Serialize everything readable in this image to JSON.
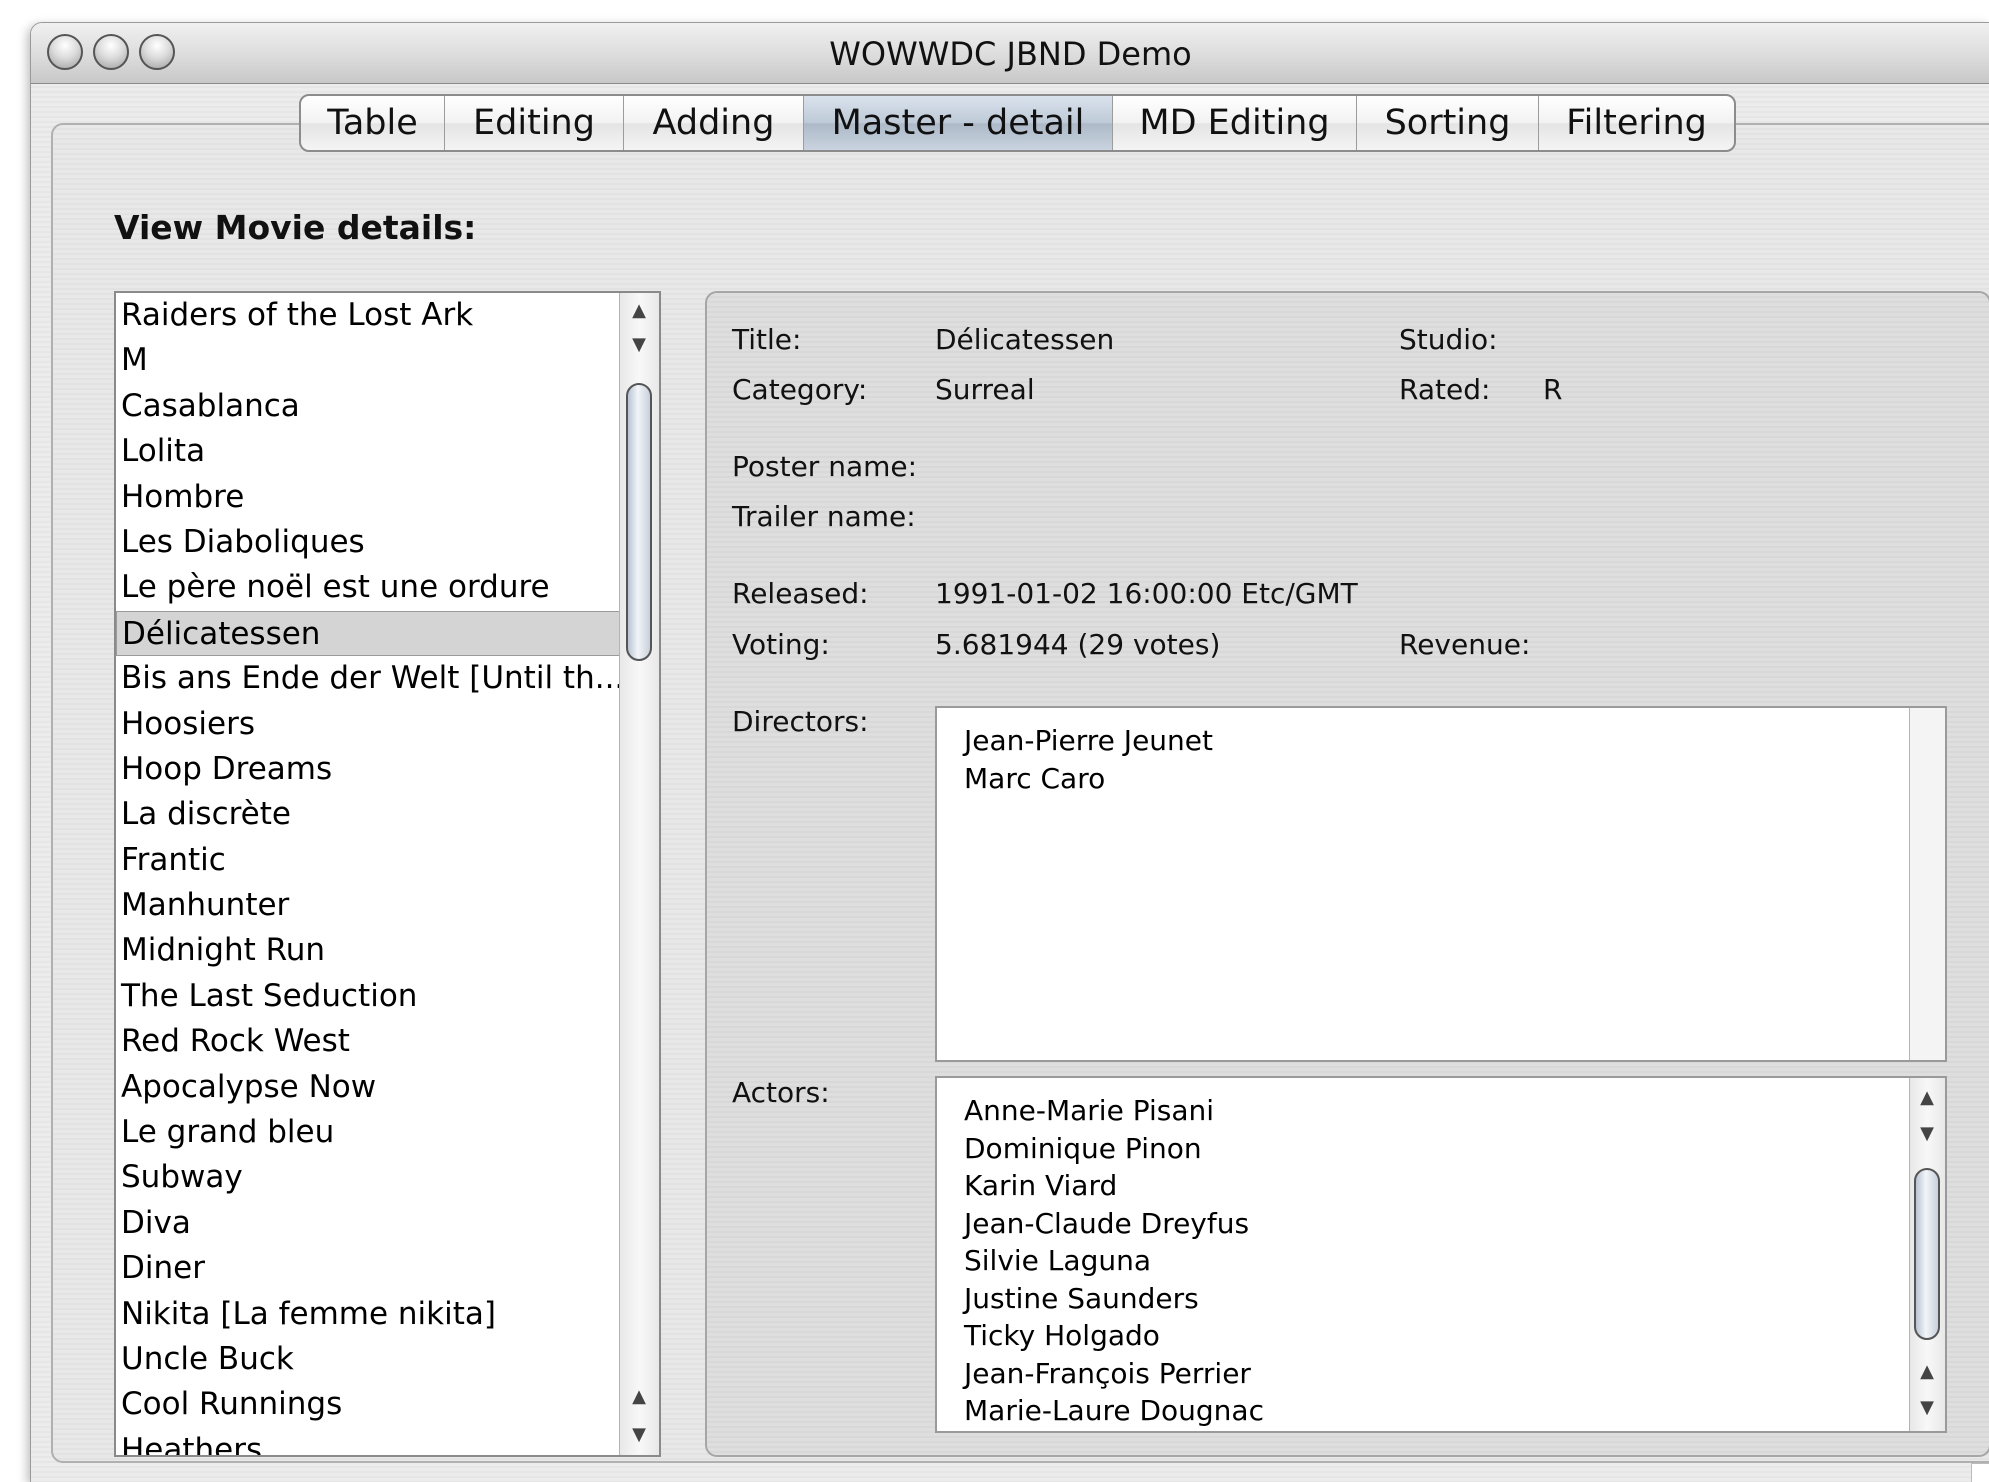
{
  "window": {
    "title": "WOWWDC JBND Demo"
  },
  "tabs": [
    {
      "label": "Table"
    },
    {
      "label": "Editing"
    },
    {
      "label": "Adding"
    },
    {
      "label": "Master - detail"
    },
    {
      "label": "MD Editing"
    },
    {
      "label": "Sorting"
    },
    {
      "label": "Filtering"
    }
  ],
  "active_tab": "Master - detail",
  "section_title": "View Movie details:",
  "movies": [
    "Raiders of the Lost Ark",
    "M",
    "Casablanca",
    "Lolita",
    "Hombre",
    "Les Diaboliques",
    "Le père noël est une ordure",
    "Délicatessen",
    "Bis ans Ende der Welt [Until th...",
    "Hoosiers",
    "Hoop Dreams",
    "La discrète",
    "Frantic",
    "Manhunter",
    "Midnight Run",
    "The Last Seduction",
    "Red Rock West",
    "Apocalypse Now",
    "Le grand bleu",
    "Subway",
    "Diva",
    "Diner",
    "Nikita [La femme nikita]",
    "Uncle Buck",
    "Cool Runnings",
    "Heathers"
  ],
  "selected_movie": "Délicatessen",
  "details": {
    "title_label": "Title:",
    "title_value": "Délicatessen",
    "studio_label": "Studio:",
    "studio_value": "",
    "category_label": "Category:",
    "category_value": "Surreal",
    "rated_label": "Rated:",
    "rated_value": "R",
    "poster_label": "Poster name:",
    "poster_value": "",
    "trailer_label": "Trailer name:",
    "trailer_value": "",
    "released_label": "Released:",
    "released_value": "1991-01-02 16:00:00 Etc/GMT",
    "voting_label": "Voting:",
    "voting_value": "5.681944 (29 votes)",
    "revenue_label": "Revenue:",
    "revenue_value": "",
    "directors_label": "Directors:",
    "directors": [
      "Jean-Pierre Jeunet",
      "Marc Caro"
    ],
    "actors_label": "Actors:",
    "actors": [
      "Anne-Marie Pisani",
      "Dominique Pinon",
      "Karin Viard",
      "Jean-Claude Dreyfus",
      "Silvie Laguna",
      "Justine Saunders",
      "Ticky Holgado",
      "Jean-François Perrier",
      "Marie-Laure Dougnac"
    ]
  },
  "icons": {
    "window_buttons": [
      "close-icon",
      "minimize-icon",
      "zoom-icon"
    ],
    "scroll_up": "▲",
    "scroll_down": "▼"
  },
  "colors": {
    "selected_tab": "#bfcad8",
    "selected_row": "#d4d4d4",
    "scroll_thumb": "#c8d0da"
  }
}
